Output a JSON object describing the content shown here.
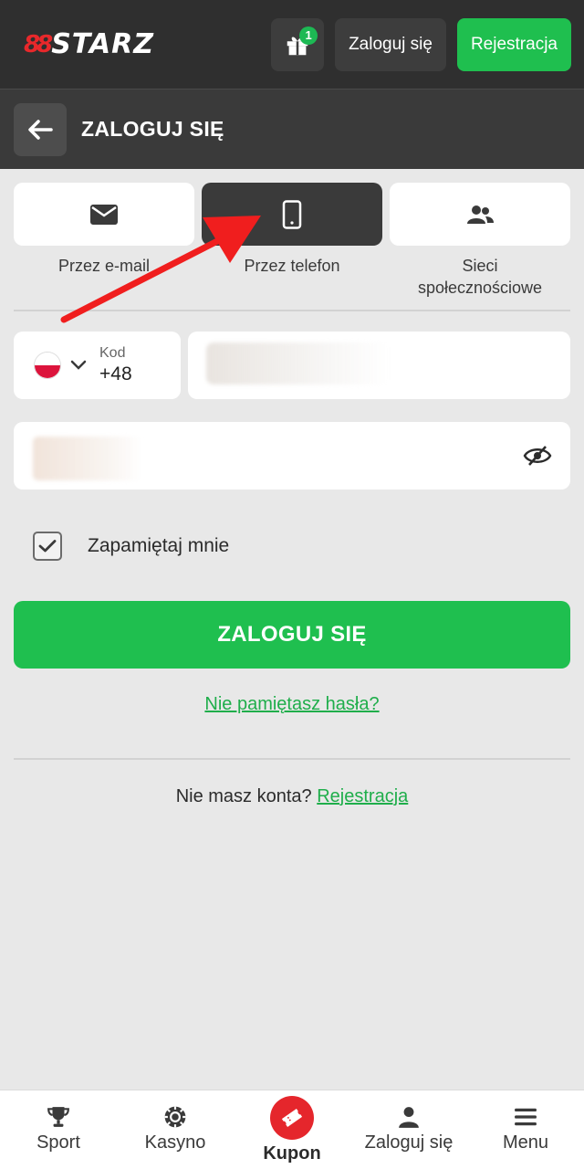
{
  "header": {
    "logo_text": "STARZ",
    "logo_mark": "88",
    "gift_badge": "1",
    "login_label": "Zaloguj się",
    "register_label": "Rejestracja"
  },
  "subheader": {
    "title": "ZALOGUJ SIĘ"
  },
  "methods": [
    {
      "label": "Przez e-mail",
      "icon": "envelope-icon",
      "active": false
    },
    {
      "label": "Przez telefon",
      "icon": "phone-icon",
      "active": true
    },
    {
      "label": "Sieci społecznościowe",
      "icon": "users-icon",
      "active": false
    }
  ],
  "phone": {
    "code_label": "Kod",
    "code_value": "+48",
    "country_icon": "poland-flag-icon"
  },
  "remember_label": "Zapamiętaj mnie",
  "login_button": "ZALOGUJ SIĘ",
  "forgot_link": "Nie pamiętasz hasła?",
  "no_account_text": "Nie masz konta?",
  "register_link": "Rejestracja",
  "bottom_nav": [
    {
      "label": "Sport",
      "icon": "trophy-icon"
    },
    {
      "label": "Kasyno",
      "icon": "casino-chip-icon"
    },
    {
      "label": "Kupon",
      "icon": "ticket-icon"
    },
    {
      "label": "Zaloguj się",
      "icon": "user-icon"
    },
    {
      "label": "Menu",
      "icon": "hamburger-icon"
    }
  ],
  "colors": {
    "accent_green": "#1fbf4f",
    "header_dark": "#2f2f2f",
    "kupon_red": "#e5262c",
    "annotation_red": "#f01e1e"
  }
}
